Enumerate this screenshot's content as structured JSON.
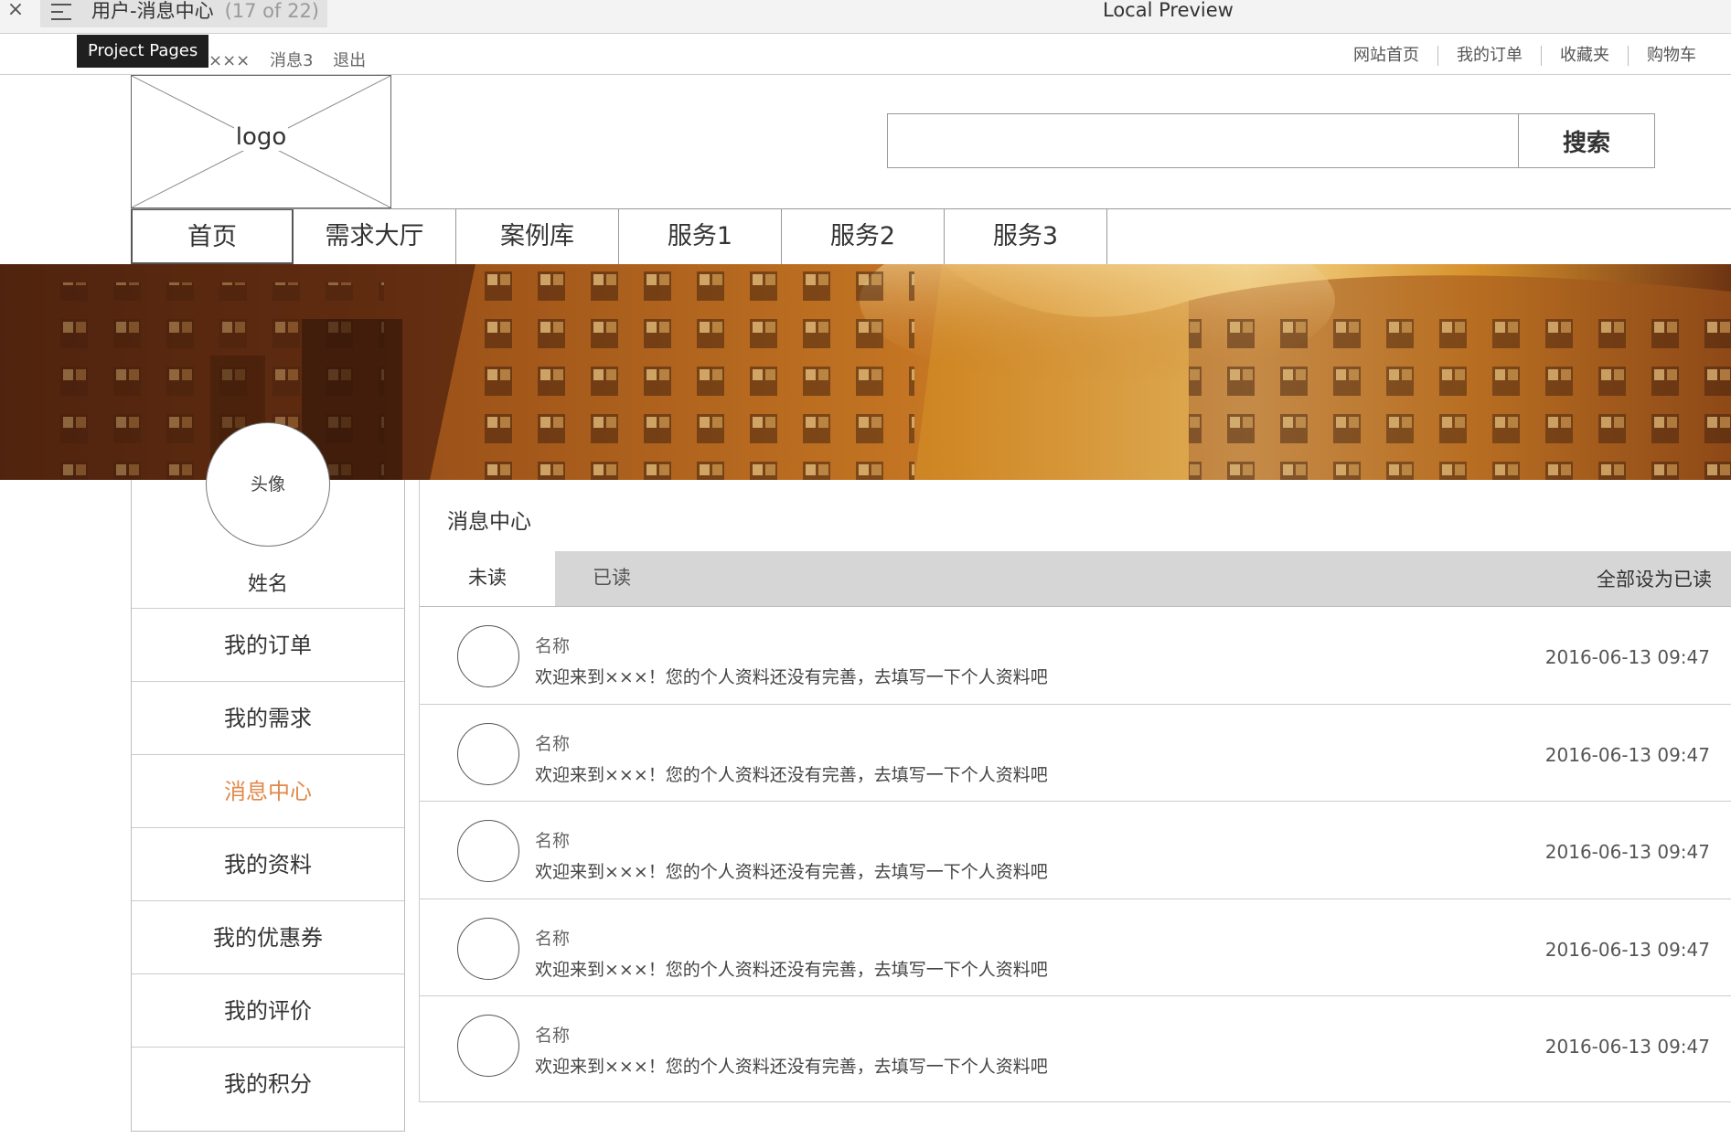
{
  "preview": {
    "close_glyph": "×",
    "page_title": "用户-消息中心",
    "page_count": "(17 of 22)",
    "center_title": "Local Preview",
    "tooltip": "Project Pages"
  },
  "topbar": {
    "user": "×××",
    "messages": "消息3",
    "logout": "退出",
    "links": [
      "网站首页",
      "我的订单",
      "收藏夹",
      "购物车"
    ]
  },
  "header": {
    "logo": "logo",
    "search_placeholder": "",
    "search_button": "搜索"
  },
  "nav": {
    "items": [
      "首页",
      "需求大厅",
      "案例库",
      "服务1",
      "服务2",
      "服务3"
    ],
    "active_index": 0
  },
  "sidebar": {
    "avatar_label": "头像",
    "name": "姓名",
    "items": [
      "我的订单",
      "我的需求",
      "消息中心",
      "我的资料",
      "我的优惠券",
      "我的评价",
      "我的积分"
    ],
    "active_index": 2,
    "active_color": "#e0894a"
  },
  "main": {
    "title": "消息中心",
    "tabs": [
      "未读",
      "已读"
    ],
    "mark_all_read": "全部设为已读",
    "messages": [
      {
        "name": "名称",
        "text": "欢迎来到×××！您的个人资料还没有完善，去填写一下个人资料吧",
        "time": "2016-06-13 09:47"
      },
      {
        "name": "名称",
        "text": "欢迎来到×××！您的个人资料还没有完善，去填写一下个人资料吧",
        "time": "2016-06-13 09:47"
      },
      {
        "name": "名称",
        "text": "欢迎来到×××！您的个人资料还没有完善，去填写一下个人资料吧",
        "time": "2016-06-13 09:47"
      },
      {
        "name": "名称",
        "text": "欢迎来到×××！您的个人资料还没有完善，去填写一下个人资料吧",
        "time": "2016-06-13 09:47"
      },
      {
        "name": "名称",
        "text": "欢迎来到×××！您的个人资料还没有完善，去填写一下个人资料吧",
        "time": "2016-06-13 09:47"
      }
    ]
  },
  "icons": {
    "close": "close-icon",
    "menu": "hamburger-menu-icon"
  }
}
